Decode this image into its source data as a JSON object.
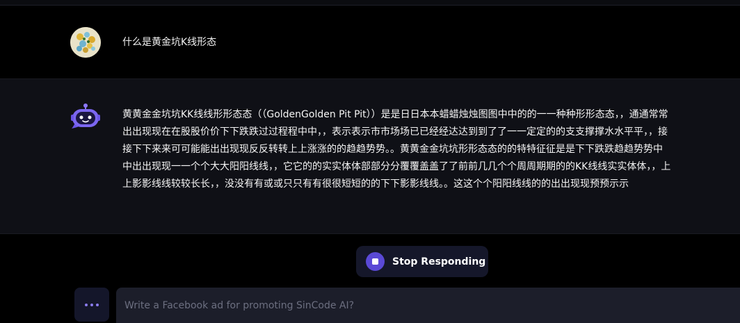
{
  "conversation": {
    "user_message": "什么是黄金坑K线形态",
    "ai_message": "黄黄金金坑坑KK线线形形态态（（GoldenGolden Pit Pit））是是日日本本蜡蜡烛烛图图中中的的一一种种形形态态，，通通常常出出现现在在股股价价下下跌跌过过程程中中，，表示表示市市场场已已经经达达到到了了一一定定的的支支撑撑水水平平，，接接下下来来可可能能出出现现反反转转上上涨涨的的趋趋势势。。黄黄金金坑坑形形态态的的特特征征是是下下跌跌趋趋势势中中出出现现一一个个大大阳阳线线，，它它的的实实体体部部分分覆覆盖盖了了前前几几个个周周期期的的KK线线实实体体，，上上影影线线较较长长，，没没有有或或只只有有很很短短的的下下影影线线。。这这个个阳阳线线的的出出现现预预示示"
  },
  "controls": {
    "stop_label": "Stop Responding",
    "input_placeholder": "Write a Facebook ad for promoting SinCode AI?"
  },
  "colors": {
    "accent": "#5a49d6",
    "ai_row_bg": "#0f1016",
    "input_bg": "#1c1e2a"
  }
}
